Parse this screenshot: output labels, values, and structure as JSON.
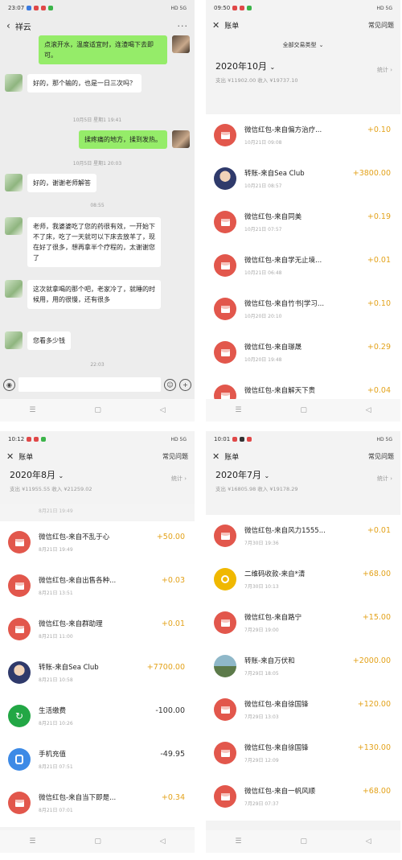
{
  "chat": {
    "status_time": "23:07",
    "title": "祥云",
    "more": "···",
    "messages": [
      {
        "side": "right",
        "text": "点滚开水，温度适宜时，连渣喝下去即可。"
      },
      {
        "side": "left",
        "text": "好的，那个输的，也是一日三次吗？"
      },
      {
        "type": "ts",
        "text": "10月5日 星期1 19:41"
      },
      {
        "side": "right",
        "text": "揉疼痛的地方，揉到发热。"
      },
      {
        "type": "ts",
        "text": "10月5日 星期1 20:03"
      },
      {
        "side": "left",
        "text": "好的，谢谢老师解答"
      },
      {
        "type": "ts",
        "text": "08:55"
      },
      {
        "side": "left",
        "text": "老师，我婆婆吃了您的药很有效，一开始下不了床，吃了一天就可以下床去放羊了，现在好了很多，想再拿半个疗程的，太谢谢您了"
      },
      {
        "side": "left",
        "text": "这次就拿喝的那个吧，老家冷了，就睡的时候用，用的很慢，还有很多"
      },
      {
        "side": "left",
        "text": "您看多少钱"
      },
      {
        "type": "ts",
        "text": "22:03"
      }
    ]
  },
  "bill_common": {
    "header_title": "账单",
    "faq": "常见问题",
    "stats": "统计",
    "close": "✕"
  },
  "october": {
    "status_time": "09:50",
    "filter": "全部交易类型",
    "month": "2020年10月",
    "summary": "支出 ¥11902.00 收入 ¥19737.10",
    "rows": [
      {
        "icon": "redpacket",
        "name": "微信红包-来自偏方治疗...",
        "time": "10月21日 09:08",
        "amount": "+0.10"
      },
      {
        "icon": "person",
        "name": "转账-来自Sea Club",
        "time": "10月21日 08:57",
        "amount": "+3800.00"
      },
      {
        "icon": "redpacket",
        "name": "微信红包-来自同美",
        "time": "10月21日 07:57",
        "amount": "+0.19"
      },
      {
        "icon": "redpacket",
        "name": "微信红包-来自学无止境...",
        "time": "10月21日 06:48",
        "amount": "+0.01"
      },
      {
        "icon": "redpacket",
        "name": "微信红包-来自竹书|学习...",
        "time": "10月20日 20:10",
        "amount": "+0.10"
      },
      {
        "icon": "redpacket",
        "name": "微信红包-来自璟晟",
        "time": "10月20日 19:48",
        "amount": "+0.29"
      },
      {
        "icon": "redpacket",
        "name": "微信红包-来自解天下贵",
        "time": "",
        "amount": "+0.04"
      }
    ]
  },
  "august": {
    "status_time": "10:12",
    "month": "2020年8月",
    "summary": "支出 ¥11955.55 收入 ¥21259.02",
    "top_partial": "8月21日 19:49",
    "rows": [
      {
        "icon": "redpacket",
        "name": "微信红包-来自不乱于心",
        "time": "8月21日 19:49",
        "amount": "+50.00"
      },
      {
        "icon": "redpacket",
        "name": "微信红包-来自出售各种...",
        "time": "8月21日 13:51",
        "amount": "+0.03"
      },
      {
        "icon": "redpacket",
        "name": "微信红包-来自群助理",
        "time": "8月21日 11:00",
        "amount": "+0.01"
      },
      {
        "icon": "person",
        "name": "转账-来自Sea Club",
        "time": "8月21日 10:58",
        "amount": "+7700.00"
      },
      {
        "icon": "life",
        "name": "生活缴费",
        "time": "8月21日 10:26",
        "amount": "-100.00"
      },
      {
        "icon": "phone",
        "name": "手机充值",
        "time": "8月21日 07:51",
        "amount": "-49.95"
      },
      {
        "icon": "redpacket",
        "name": "微信红包-来自当下即是...",
        "time": "8月21日 07:01",
        "amount": "+0.34"
      }
    ]
  },
  "july": {
    "status_time": "10:01",
    "month": "2020年7月",
    "summary": "支出 ¥16805.98 收入 ¥19178.29",
    "rows": [
      {
        "icon": "redpacket",
        "name": "微信红包-来自风力1555...",
        "time": "7月30日 19:36",
        "amount": "+0.01"
      },
      {
        "icon": "qr",
        "name": "二维码收款-来自*清",
        "time": "7月30日 10:13",
        "amount": "+68.00"
      },
      {
        "icon": "redpacket",
        "name": "微信红包-来自路宁",
        "time": "7月29日 19:00",
        "amount": "+15.00"
      },
      {
        "icon": "landscape",
        "name": "转账-来自万伏和",
        "time": "7月29日 18:05",
        "amount": "+2000.00"
      },
      {
        "icon": "redpacket",
        "name": "微信红包-来自徐国锋",
        "time": "7月29日 13:03",
        "amount": "+120.00"
      },
      {
        "icon": "redpacket",
        "name": "微信红包-来自徐国锋",
        "time": "7月29日 12:09",
        "amount": "+130.00"
      },
      {
        "icon": "redpacket",
        "name": "微信红包-来自一帆风顺",
        "time": "7月29日 07:37",
        "amount": "+68.00"
      }
    ]
  },
  "nav": {
    "menu": "☰",
    "home": "▢",
    "back": "◁"
  },
  "status_right": "HD 5G"
}
